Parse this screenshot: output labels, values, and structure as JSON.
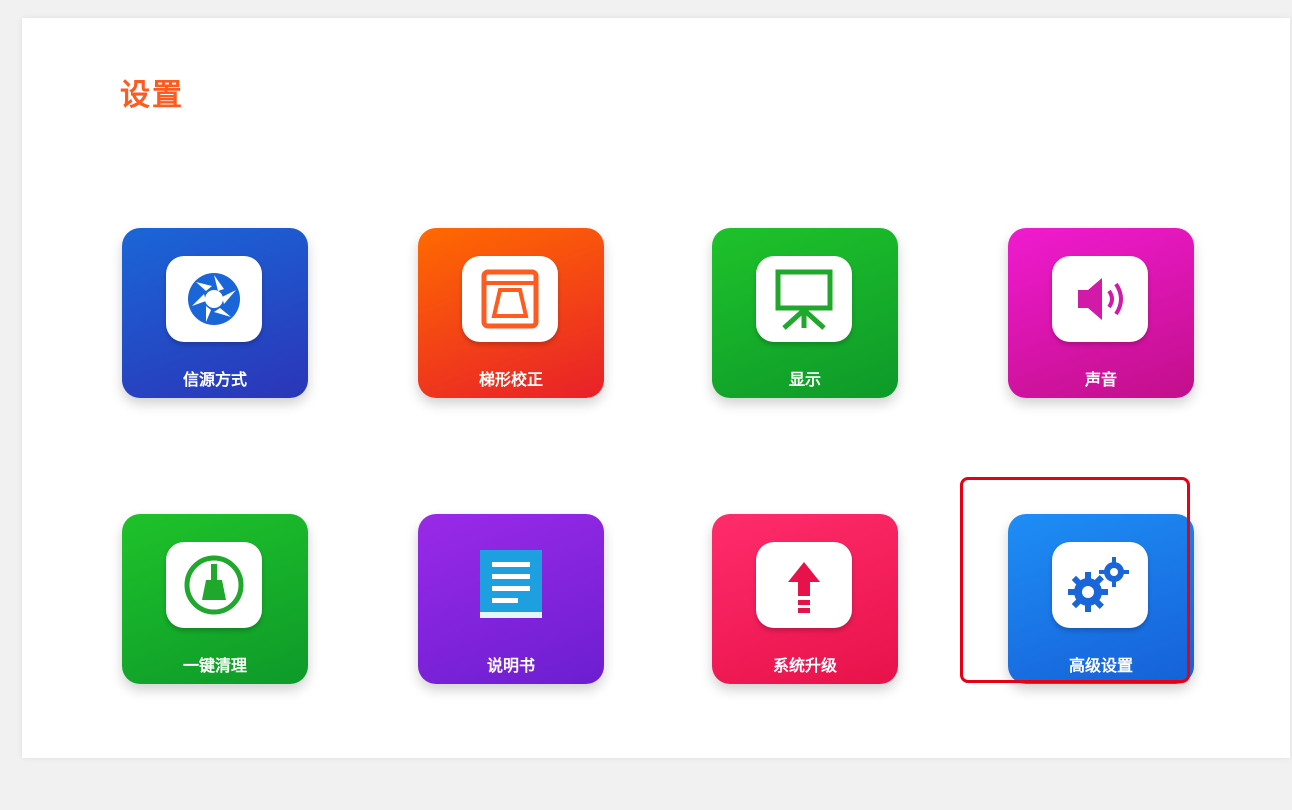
{
  "page": {
    "title": "设置"
  },
  "tiles": [
    {
      "label": "信源方式",
      "icon": "aperture-icon",
      "gradient": [
        "#1a66d8",
        "#2b35b8"
      ],
      "accent": "#1a66d8"
    },
    {
      "label": "梯形校正",
      "icon": "keystone-icon",
      "gradient": [
        "#ff6a00",
        "#e8202a"
      ],
      "accent": "#ff5a1f"
    },
    {
      "label": "显示",
      "icon": "projector-screen-icon",
      "gradient": [
        "#1ec22a",
        "#0e9a2a"
      ],
      "accent": "#1fa82c"
    },
    {
      "label": "声音",
      "icon": "speaker-icon",
      "gradient": [
        "#f01bd0",
        "#c20f8a"
      ],
      "accent": "#d11aa8"
    },
    {
      "label": "一键清理",
      "icon": "broom-icon",
      "gradient": [
        "#1ec22a",
        "#0e9a2a"
      ],
      "accent": "#1fa82c"
    },
    {
      "label": "说明书",
      "icon": "manual-book-icon",
      "gradient": [
        "#9a2ae8",
        "#6c1ed0"
      ],
      "accent": "#1ea0e0"
    },
    {
      "label": "系统升级",
      "icon": "upgrade-icon",
      "gradient": [
        "#ff2c6c",
        "#e8124a"
      ],
      "accent": "#e8124a"
    },
    {
      "label": "高级设置",
      "icon": "gears-icon",
      "gradient": [
        "#1e8ef5",
        "#1660d8"
      ],
      "accent": "#1a66d8",
      "selected": true
    }
  ]
}
